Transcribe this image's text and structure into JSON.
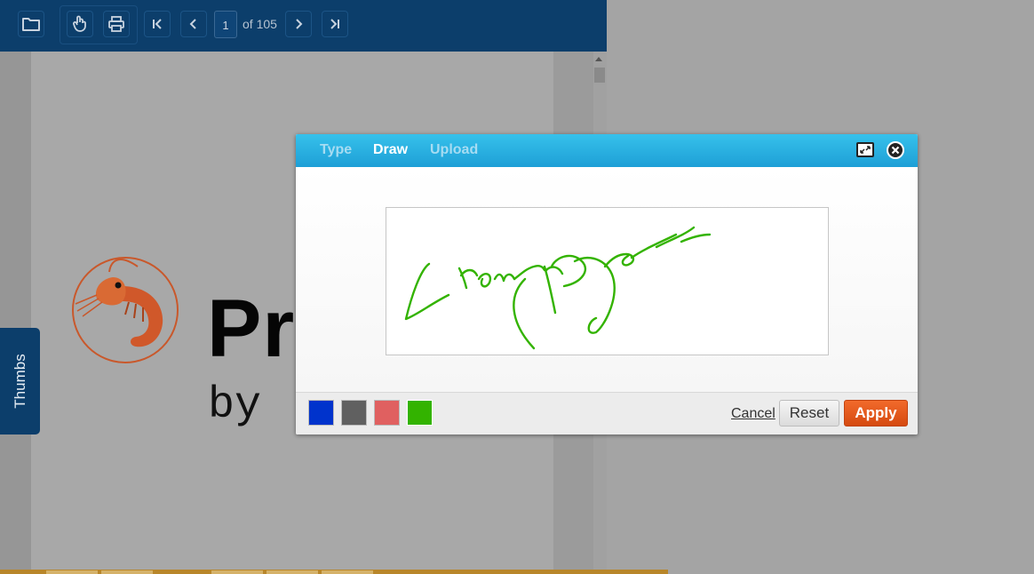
{
  "toolbar": {
    "page_input_value": "1",
    "page_count_label": "of 105",
    "buttons": [
      "folder-icon",
      "hand-tool-icon",
      "print-icon",
      "first-page-icon",
      "prev-page-icon",
      "next-page-icon",
      "last-page-icon"
    ]
  },
  "sidebar": {
    "thumbs_label": "Thumbs"
  },
  "document": {
    "title_fragment": "Pr",
    "subtitle_fragment": "by"
  },
  "dialog": {
    "tabs": [
      {
        "label": "Type",
        "active": false
      },
      {
        "label": "Draw",
        "active": true
      },
      {
        "label": "Upload",
        "active": false
      }
    ],
    "colors": [
      "#0033cc",
      "#606060",
      "#e06060",
      "#33b300"
    ],
    "selected_color": "#33b300",
    "cancel_label": "Cancel",
    "reset_label": "Reset",
    "apply_label": "Apply"
  },
  "theme": {
    "toolbar_bg": "#0c3e6b",
    "dialog_header": "#1e9fd6",
    "apply_color": "#d54a10",
    "signature_color": "#33b300"
  }
}
